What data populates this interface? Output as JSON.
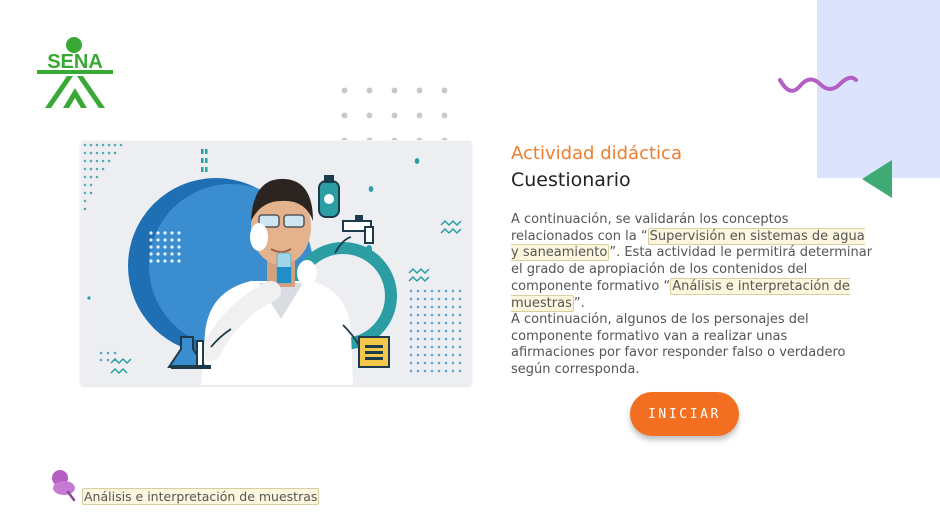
{
  "brand": {
    "logo_text": "SENA",
    "logo_color": "#39a935"
  },
  "activity": {
    "label": "Actividad didáctica",
    "title": "Cuestionario"
  },
  "intro": {
    "part1": "A continuación, se validarán los conceptos relacionados con la “",
    "link1": "Supervisión en sistemas de agua y saneamiento",
    "part2": "”. Esta actividad le permitirá determinar el grado de apropiación de los contenidos del componente formativo “",
    "link2": "Análisis e interpretación de muestras",
    "part3": "”."
  },
  "instructions": "A continuación, algunos de los personajes del componente formativo van a realizar unas afirmaciones por favor responder falso o verdadero según corresponda.",
  "start_button": {
    "label": "INICIAR"
  },
  "footer": {
    "link_label": "Análisis e interpretación de muestras"
  },
  "colors": {
    "accent": "#f26f21",
    "title_orange": "#ef7d2d",
    "green": "#3faa73",
    "lavender": "#dbe3fd",
    "purple": "#b35fc4",
    "blue": "#2f7fc6",
    "teal": "#2a9ea3"
  }
}
